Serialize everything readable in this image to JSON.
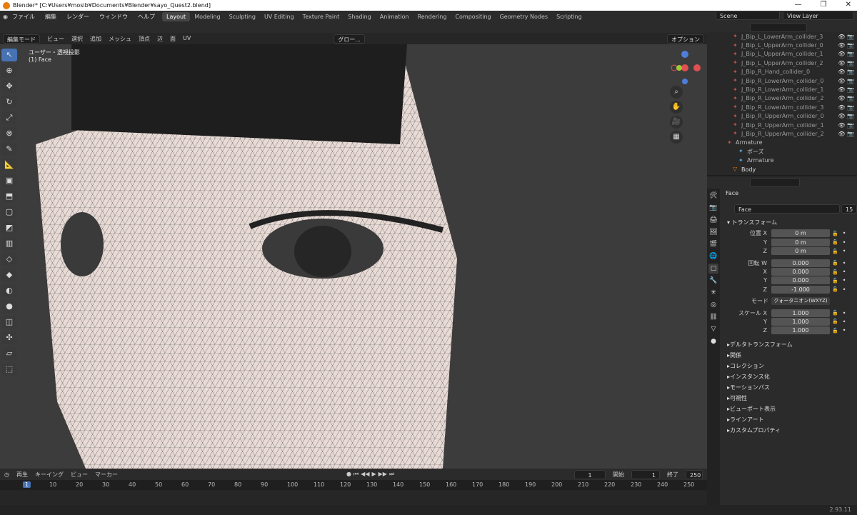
{
  "window": {
    "title": "Blender* [C:¥Users¥mosib¥Documents¥Blender¥sayo_Quest2.blend]"
  },
  "menu": [
    "ファイル",
    "編集",
    "レンダー",
    "ウィンドウ",
    "ヘルプ"
  ],
  "workspaces": [
    "Layout",
    "Modeling",
    "Sculpting",
    "UV Editing",
    "Texture Paint",
    "Shading",
    "Animation",
    "Rendering",
    "Compositing",
    "Geometry Nodes",
    "Scripting"
  ],
  "active_workspace": "Layout",
  "scene": {
    "label": "Scene",
    "view_layer": "View Layer"
  },
  "viewport_header": {
    "mode": "編集モード",
    "menus": [
      "ビュー",
      "選択",
      "追加",
      "メッシュ",
      "頂点",
      "辺",
      "面",
      "UV"
    ],
    "transform": "グロー...",
    "option": "オプション"
  },
  "viewport": {
    "view_label": "ユーザー・透視投影",
    "object_label": "(1) Face"
  },
  "outliner": {
    "items": [
      "J_Bip_L_LowerArm_collider_3",
      "J_Bip_L_UpperArm_collider_0",
      "J_Bip_L_UpperArm_collider_1",
      "J_Bip_L_UpperArm_collider_2",
      "J_Bip_R_Hand_collider_0",
      "J_Bip_R_LowerArm_collider_0",
      "J_Bip_R_LowerArm_collider_1",
      "J_Bip_R_LowerArm_collider_2",
      "J_Bip_R_LowerArm_collider_3",
      "J_Bip_R_UpperArm_collider_0",
      "J_Bip_R_UpperArm_collider_1",
      "J_Bip_R_UpperArm_collider_2"
    ],
    "armature": "Armature",
    "pose": "ポーズ",
    "armature_data": "Armature",
    "body": "Body"
  },
  "properties": {
    "object_name": "Face",
    "data_name": "Face",
    "users": "15",
    "section": "トランスフォーム",
    "location": {
      "label": "位置 X",
      "x": "0 m",
      "y": "0 m",
      "z": "0 m"
    },
    "rotation": {
      "label": "回転 W",
      "w": "0.000",
      "x": "0.000",
      "y": "0.000",
      "z": "-1.000"
    },
    "mode": {
      "label": "モード",
      "value": "クォータニオン(WXYZ)"
    },
    "scale": {
      "label": "スケール X",
      "x": "1.000",
      "y": "1.000",
      "z": "1.000"
    },
    "axis": {
      "x": "X",
      "y": "Y",
      "z": "Z"
    },
    "subsections": [
      "デルタトランスフォーム",
      "関係",
      "コレクション",
      "インスタンス化",
      "モーションパス",
      "可視性",
      "ビューポート表示",
      "ラインアート",
      "カスタムプロパティ"
    ]
  },
  "timeline": {
    "menus": [
      "再生",
      "キーイング",
      "ビュー",
      "マーカー"
    ],
    "current": "1",
    "start_label": "開始",
    "start": "1",
    "end_label": "終了",
    "end": "250",
    "ticks": [
      "1",
      "10",
      "20",
      "30",
      "40",
      "50",
      "60",
      "70",
      "80",
      "90",
      "100",
      "110",
      "120",
      "130",
      "140",
      "150",
      "160",
      "170",
      "180",
      "190",
      "200",
      "210",
      "220",
      "230",
      "240",
      "250"
    ]
  },
  "version": "2.93.11"
}
